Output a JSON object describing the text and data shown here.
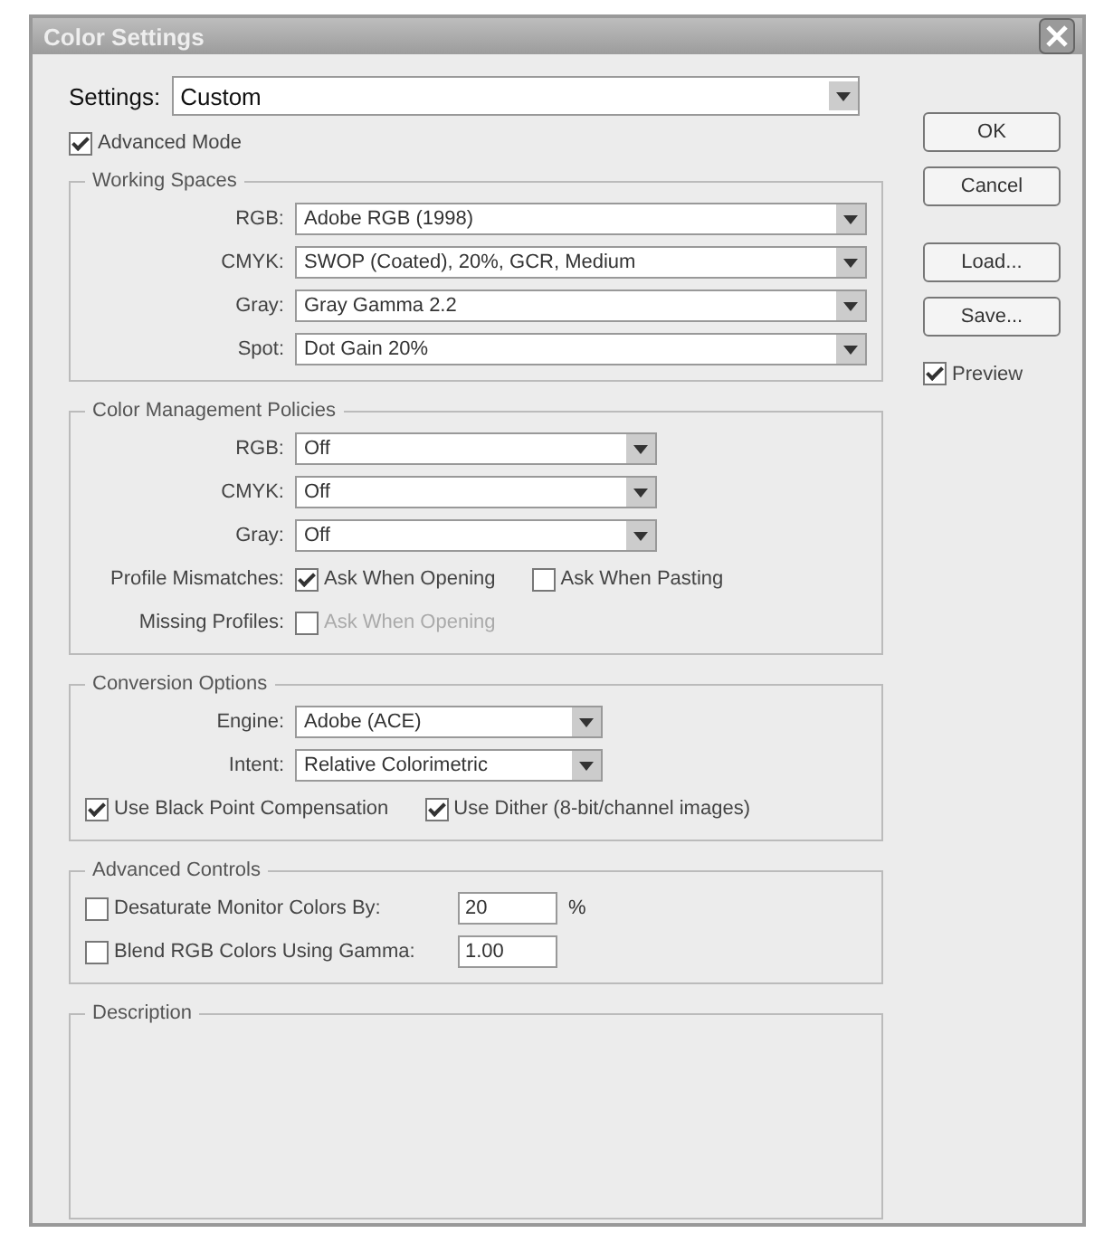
{
  "window": {
    "title": "Color Settings"
  },
  "settings": {
    "label": "Settings:",
    "value": "Custom"
  },
  "advanced_mode": {
    "label": "Advanced Mode",
    "checked": true
  },
  "working_spaces": {
    "title": "Working Spaces",
    "rows": [
      {
        "label": "RGB:",
        "value": "Adobe RGB (1998)"
      },
      {
        "label": "CMYK:",
        "value": "SWOP (Coated), 20%, GCR, Medium"
      },
      {
        "label": "Gray:",
        "value": "Gray Gamma 2.2"
      },
      {
        "label": "Spot:",
        "value": "Dot Gain 20%"
      }
    ]
  },
  "policies": {
    "title": "Color Management Policies",
    "rows": [
      {
        "label": "RGB:",
        "value": "Off"
      },
      {
        "label": "CMYK:",
        "value": "Off"
      },
      {
        "label": "Gray:",
        "value": "Off"
      }
    ],
    "mismatches": {
      "label": "Profile Mismatches:",
      "options": [
        {
          "label": "Ask When Opening",
          "checked": true,
          "disabled": false
        },
        {
          "label": "Ask When Pasting",
          "checked": false,
          "disabled": false
        }
      ]
    },
    "missing": {
      "label": "Missing Profiles:",
      "options": [
        {
          "label": "Ask When Opening",
          "checked": false,
          "disabled": true
        }
      ]
    }
  },
  "conversion": {
    "title": "Conversion Options",
    "engine": {
      "label": "Engine:",
      "value": "Adobe (ACE)"
    },
    "intent": {
      "label": "Intent:",
      "value": "Relative Colorimetric"
    },
    "options": [
      {
        "label": "Use Black Point Compensation",
        "checked": true
      },
      {
        "label": "Use Dither (8-bit/channel images)",
        "checked": true
      }
    ]
  },
  "advanced_controls": {
    "title": "Advanced Controls",
    "rows": [
      {
        "label": "Desaturate Monitor Colors By:",
        "checked": false,
        "value": "20",
        "unit": "%"
      },
      {
        "label": "Blend RGB Colors Using Gamma:",
        "checked": false,
        "value": "1.00"
      }
    ]
  },
  "description": {
    "title": "Description"
  },
  "buttons": [
    "OK",
    "Cancel",
    "Load...",
    "Save..."
  ],
  "preview": {
    "label": "Preview",
    "checked": true
  }
}
